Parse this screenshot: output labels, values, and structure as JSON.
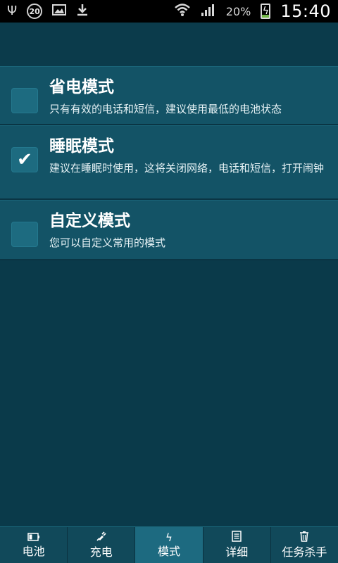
{
  "status_bar": {
    "notification_count": "20",
    "battery_percent": "20%",
    "time": "15:40",
    "icons": [
      "usb-icon",
      "image-icon",
      "download-icon",
      "wifi-icon",
      "signal-icon",
      "battery-charging-icon"
    ]
  },
  "modes": [
    {
      "title": "省电模式",
      "desc": "只有有效的电话和短信，建议使用最低的电池状态",
      "checked": false
    },
    {
      "title": "睡眠模式",
      "desc": "建议在睡眠时使用，这将关闭网络，电话和短信，打开闹钟",
      "checked": true
    },
    {
      "title": "自定义模式",
      "desc": "您可以自定义常用的模式",
      "checked": false
    }
  ],
  "nav": {
    "tabs": [
      {
        "label": "电池",
        "icon": "battery-icon"
      },
      {
        "label": "充电",
        "icon": "plug-icon"
      },
      {
        "label": "模式",
        "icon": "bolt-icon",
        "active": true
      },
      {
        "label": "详细",
        "icon": "document-icon"
      },
      {
        "label": "任务杀手",
        "icon": "trash-icon"
      }
    ]
  },
  "colors": {
    "background": "#0a3a4a",
    "item": "#135366",
    "active_tab": "#1d6a80"
  }
}
